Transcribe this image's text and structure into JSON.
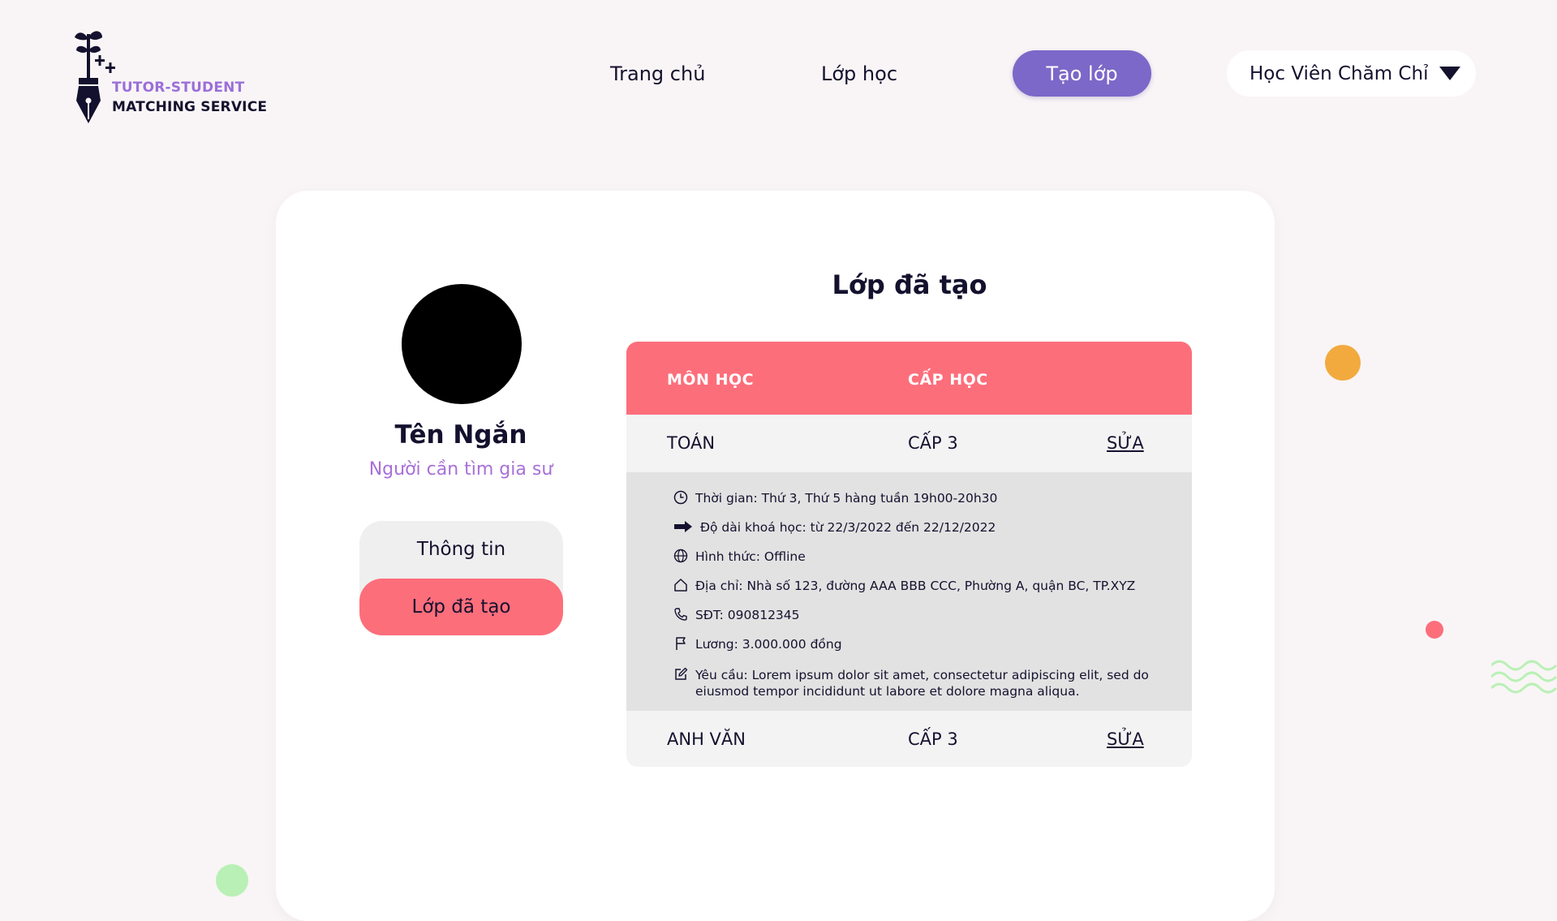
{
  "logo": {
    "line1": "TUTOR-STUDENT",
    "line2": "MATCHING SERVICE"
  },
  "nav": {
    "home": "Trang chủ",
    "classes": "Lớp học",
    "create": "Tạo lớp",
    "user": "Học Viên Chăm Chỉ"
  },
  "profile": {
    "name": "Tên Ngắn",
    "role": "Người cần tìm gia sư"
  },
  "side_menu": {
    "info": "Thông tin",
    "created": "Lớp đã tạo"
  },
  "section_title": "Lớp đã tạo",
  "table": {
    "headers": [
      "MÔN HỌC",
      "CẤP HỌC"
    ],
    "rows": [
      {
        "subject": "TOÁN",
        "level": "CẤP 3",
        "action": "SỬA"
      },
      {
        "subject": "ANH VĂN",
        "level": "CẤP 3",
        "action": "SỬA"
      }
    ],
    "details": {
      "time": "Thời gian: Thứ 3, Thứ 5 hàng tuần 19h00-20h30",
      "duration": "Độ dài khoá học: từ 22/3/2022 đến 22/12/2022",
      "mode": "Hình thức: Offline",
      "address": "Địa chỉ: Nhà số 123, đường AAA BBB CCC, Phường A, quận BC, TP.XYZ",
      "phone": "SĐT: 090812345",
      "salary": "Lương: 3.000.000 đồng",
      "requirement": "Yêu cầu: Lorem ipsum dolor sit amet, consectetur adipiscing elit, sed do eiusmod tempor incididunt ut labore et dolore magna aliqua."
    }
  },
  "colors": {
    "accent": "#7b68c8",
    "coral": "#fd6e7b",
    "purple_text": "#a870d8",
    "orange": "#f2aa3f",
    "green": "#b9f0b5"
  }
}
